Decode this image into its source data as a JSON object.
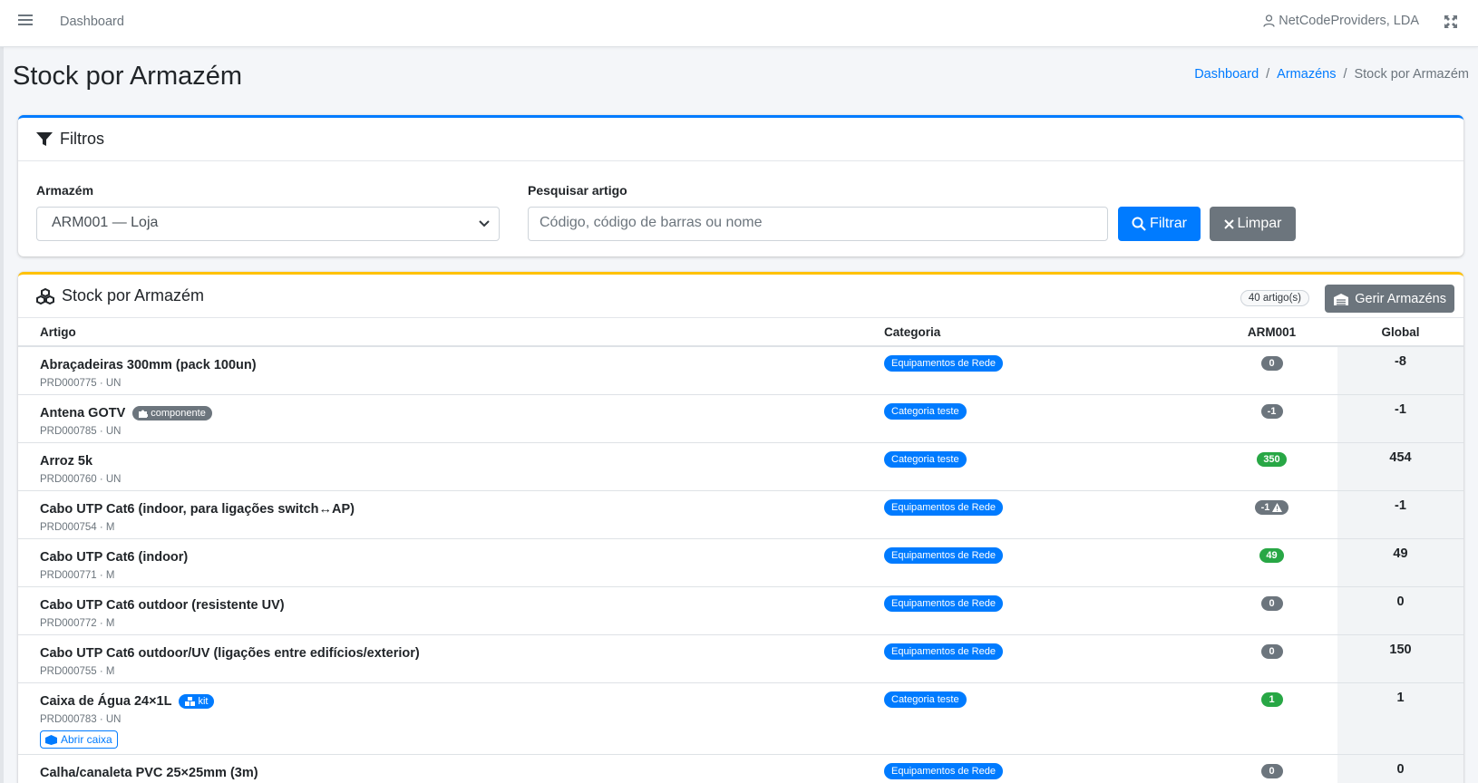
{
  "topbar": {
    "dashboard_label": "Dashboard",
    "user_label": "NetCodeProviders, LDA"
  },
  "page": {
    "title": "Stock por Armazém",
    "breadcrumb": [
      "Dashboard",
      "Armazéns",
      "Stock por Armazém"
    ]
  },
  "filters": {
    "header": "Filtros",
    "warehouse_label": "Armazém",
    "warehouse_value": "ARM001 — Loja",
    "search_label": "Pesquisar artigo",
    "search_placeholder": "Código, código de barras ou nome",
    "filter_button": "Filtrar",
    "clear_button": "Limpar"
  },
  "stock": {
    "header": "Stock por Armazém",
    "count": "40 artigo(s)",
    "manage_button": "Gerir Armazéns",
    "columns": [
      "Artigo",
      "Categoria",
      "ARM001",
      "Global"
    ],
    "rows": [
      {
        "name": "Abraçadeiras 300mm (pack 100un)",
        "meta": "PRD000775 · UN",
        "category": "Equipamentos de Rede",
        "qty": "0",
        "qty_color": "gray",
        "global": "-8"
      },
      {
        "name": "Antena GOTV",
        "tag": "componente",
        "tag_color": "gray",
        "meta": "PRD000785 · UN",
        "category": "Categoria teste",
        "qty": "-1",
        "qty_color": "gray",
        "global": "-1"
      },
      {
        "name": "Arroz 5k",
        "meta": "PRD000760 · UN",
        "category": "Categoria teste",
        "qty": "350",
        "qty_color": "green",
        "global": "454"
      },
      {
        "name": "Cabo UTP Cat6 (indoor, para ligações switch↔AP)",
        "meta": "PRD000754 · M",
        "category": "Equipamentos de Rede",
        "qty": "-1",
        "qty_color": "gray",
        "warn": true,
        "global": "-1"
      },
      {
        "name": "Cabo UTP Cat6 (indoor)",
        "meta": "PRD000771 · M",
        "category": "Equipamentos de Rede",
        "qty": "49",
        "qty_color": "green",
        "global": "49"
      },
      {
        "name": "Cabo UTP Cat6 outdoor (resistente UV)",
        "meta": "PRD000772 · M",
        "category": "Equipamentos de Rede",
        "qty": "0",
        "qty_color": "gray",
        "global": "0"
      },
      {
        "name": "Cabo UTP Cat6 outdoor/UV (ligações entre edifícios/exterior)",
        "meta": "PRD000755 · M",
        "category": "Equipamentos de Rede",
        "qty": "0",
        "qty_color": "gray",
        "global": "150"
      },
      {
        "name": "Caixa de Água 24×1L",
        "tag": "kit",
        "tag_color": "blue",
        "meta": "PRD000783 · UN",
        "action": "Abrir caixa",
        "category": "Categoria teste",
        "qty": "1",
        "qty_color": "green",
        "global": "1"
      },
      {
        "name": "Calha/canaleta PVC 25×25mm (3m)",
        "meta": "",
        "category": "Equipamentos de Rede",
        "qty": "0",
        "qty_color": "gray",
        "global": "0"
      }
    ]
  }
}
